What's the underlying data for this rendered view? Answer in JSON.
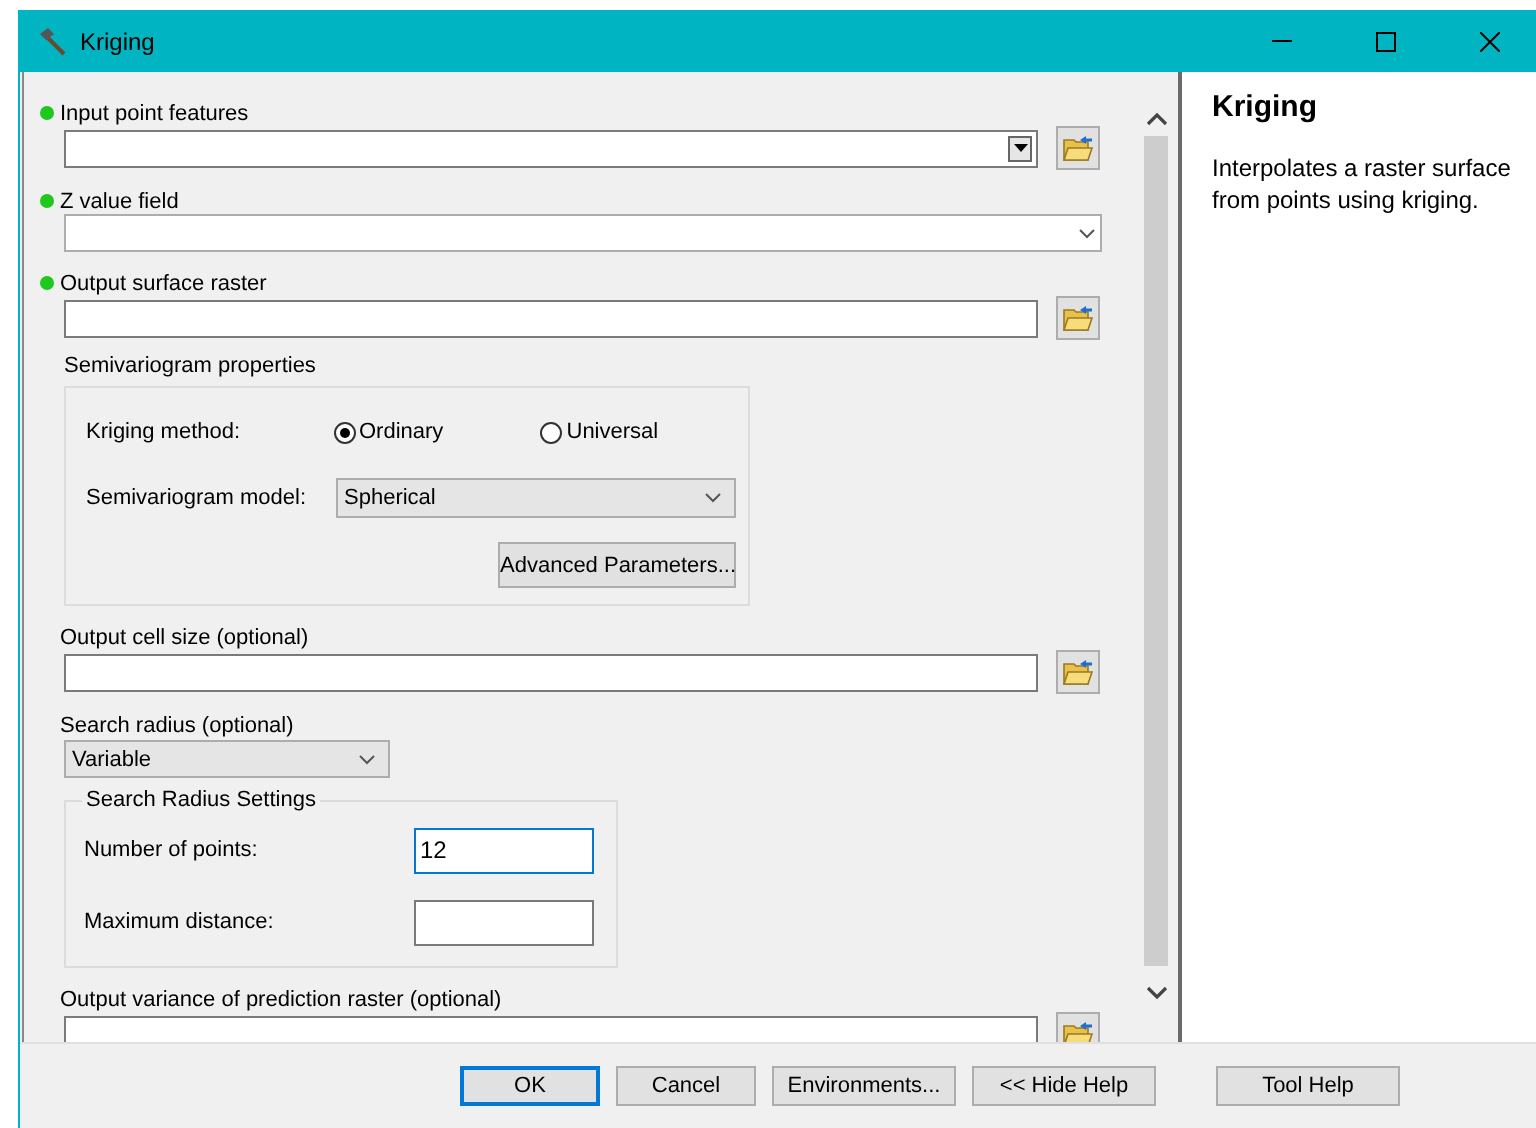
{
  "window": {
    "title": "Kriging"
  },
  "parameters": [
    {
      "kind": "combo",
      "label": "Input point features",
      "required": true
    },
    {
      "kind": "dropdown",
      "label": "Z value field",
      "required": true
    },
    {
      "kind": "text",
      "label": "Output surface raster",
      "required": true
    },
    {
      "kind": "semivariogram",
      "label": "Semivariogram properties",
      "method_label": "Kriging method:",
      "methods": [
        {
          "label": "Ordinary",
          "selected": true
        },
        {
          "label": "Universal",
          "selected": false
        }
      ],
      "model_label": "Semivariogram model:",
      "model_value": "Spherical",
      "button": "Advanced Parameters..."
    },
    {
      "kind": "text",
      "label": "Output cell size (optional)",
      "required": false
    },
    {
      "kind": "search",
      "label": "Search radius (optional)",
      "required": false,
      "value": "Variable",
      "group_title": "Search Radius Settings",
      "fields": [
        {
          "label": "Number of points:",
          "value": "12",
          "focused": true
        },
        {
          "label": "Maximum distance:",
          "focused": false
        }
      ]
    },
    {
      "kind": "text",
      "label": "Output variance of prediction raster (optional)",
      "required": false
    }
  ],
  "help": {
    "title": "Kriging",
    "text": "Interpolates a raster surface from points using kriging."
  },
  "buttons": [
    {
      "label": "OK",
      "default": true
    },
    {
      "label": "Cancel",
      "default": false
    },
    {
      "label": "Environments...",
      "default": false
    },
    {
      "label": "<< Hide Help",
      "default": false
    },
    {
      "label": "Tool Help",
      "default": false
    }
  ]
}
